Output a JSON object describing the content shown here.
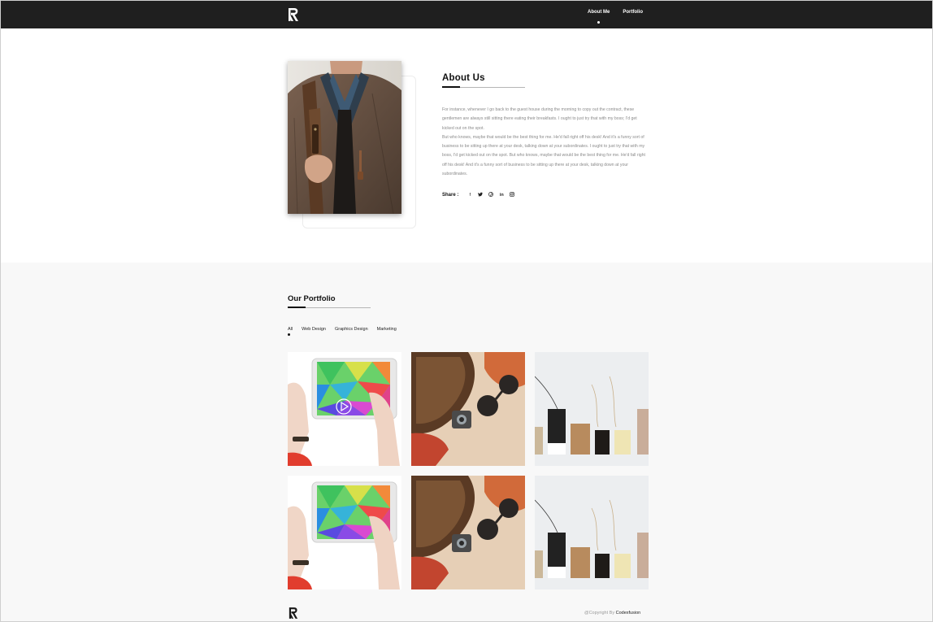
{
  "nav": {
    "links": [
      {
        "label": "About Me",
        "active": true
      },
      {
        "label": "Portfolio",
        "active": false
      }
    ]
  },
  "about": {
    "title": "About Us",
    "paragraph1": "For instance, whenever I go back to the guest house during the morning to copy out the contract, these gentlemen are always still sitting there eating their breakfasts. I ought to just try that with my boss; I'd get kicked out on the spot.",
    "paragraph2": "But who knows, maybe that would be the best thing for me. He'd fall right off his desk! And it's a funny sort of business to be sitting up there at your desk, talking down at your subordinates. I ought to just try that with my boss, I'd get kicked out on the spot. But who knows, maybe that would be the best thing for me. He'd fall right off his desk! And it's a funny sort of business to be sitting up there at your desk, talking down at your subordinates.",
    "share_label": "Share :",
    "share_icons": [
      "facebook-icon",
      "twitter-icon",
      "pinterest-icon",
      "linkedin-icon",
      "instagram-icon"
    ]
  },
  "portfolio": {
    "title": "Our Portfolio",
    "filters": [
      {
        "label": "All",
        "active": true
      },
      {
        "label": "Web Design",
        "active": false
      },
      {
        "label": "Graphics Design",
        "active": false
      },
      {
        "label": "Marketing",
        "active": false
      }
    ],
    "items": [
      {
        "image": "tablet-hands",
        "video": true
      },
      {
        "image": "bag-sunglasses",
        "video": false
      },
      {
        "image": "price-tags",
        "video": false
      },
      {
        "image": "tablet-hands",
        "video": false
      },
      {
        "image": "bag-sunglasses",
        "video": false
      },
      {
        "image": "price-tags",
        "video": false
      }
    ]
  },
  "footer": {
    "copyright_prefix": "@Copyright By",
    "brand": "Codexfusion"
  },
  "colors": {
    "navbar": "#1f1f1f",
    "portfolio_bg": "#f8f8f8",
    "text_muted": "#8a8a8a"
  }
}
